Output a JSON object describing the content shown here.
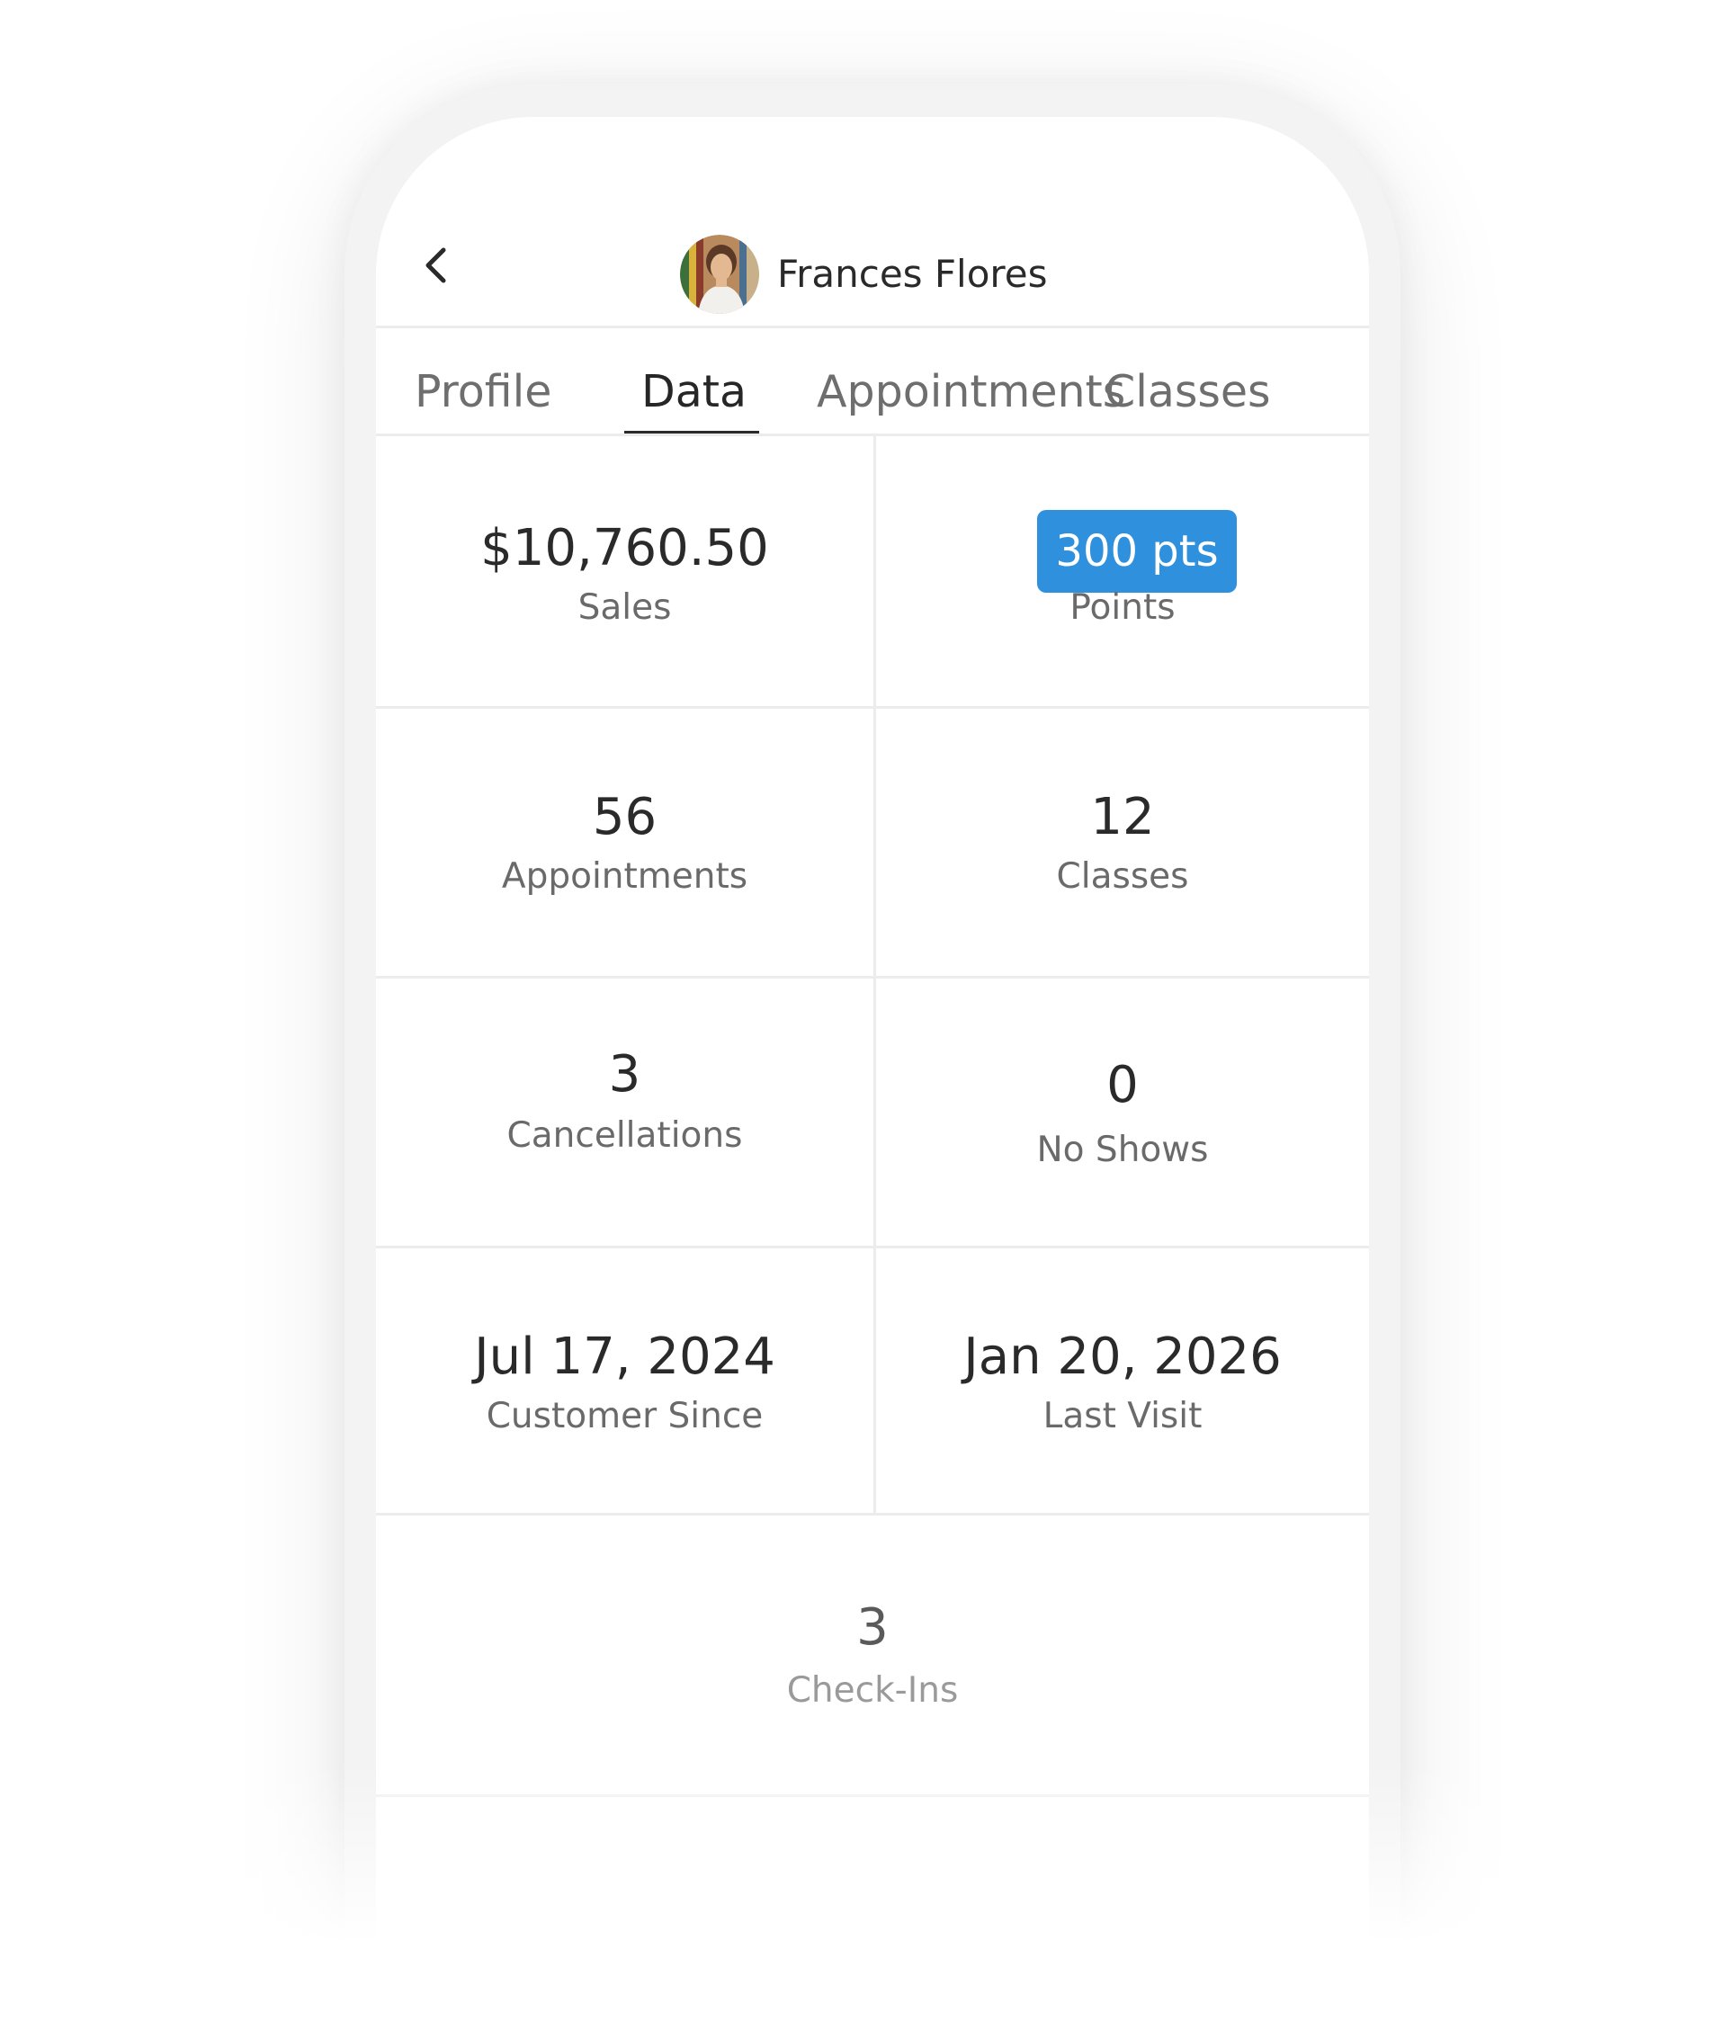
{
  "header": {
    "name": "Frances Flores"
  },
  "tabs": [
    {
      "label": "Profile",
      "active": false
    },
    {
      "label": "Data",
      "active": true
    },
    {
      "label": "Appointments",
      "active": false
    },
    {
      "label": "Classes",
      "active": false
    }
  ],
  "stats": {
    "sales": {
      "value": "$10,760.50",
      "label": "Sales"
    },
    "points": {
      "value": "300 pts",
      "label": "Points"
    },
    "appointments": {
      "value": "56",
      "label": "Appointments"
    },
    "classes": {
      "value": "12",
      "label": "Classes"
    },
    "cancellations": {
      "value": "3",
      "label": "Cancellations"
    },
    "no_shows": {
      "value": "0",
      "label": "No Shows"
    },
    "customer_since": {
      "value": "Jul 17, 2024",
      "label": "Customer Since"
    },
    "last_visit": {
      "value": "Jan 20, 2026",
      "label": "Last Visit"
    },
    "check_ins": {
      "value": "3",
      "label": "Check-Ins"
    }
  },
  "colors": {
    "accent": "#2f91dd",
    "divider": "#ececec",
    "text_primary": "#2a2a2a",
    "text_secondary": "#6a6a6a"
  },
  "icons": {
    "back": "chevron-left-icon",
    "avatar": "user-avatar-photo"
  }
}
